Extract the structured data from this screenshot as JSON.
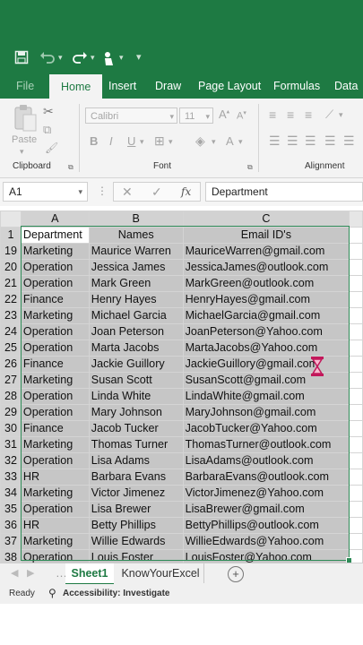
{
  "quick_access": {
    "save_icon": "save-icon",
    "undo_icon": "undo-icon",
    "redo_icon": "redo-icon",
    "touch_icon": "touch-mode-icon",
    "more_icon": "customize-icon"
  },
  "ribbon_tabs": [
    {
      "label": "File"
    },
    {
      "label": "Home"
    },
    {
      "label": "Insert"
    },
    {
      "label": "Draw"
    },
    {
      "label": "Page Layout"
    },
    {
      "label": "Formulas"
    },
    {
      "label": "Data"
    }
  ],
  "ribbon": {
    "clipboard_label": "Clipboard",
    "paste_label": "Paste",
    "font_label": "Font",
    "font_name": "Calibri",
    "font_size": "11",
    "alignment_label": "Alignment",
    "bold": "B",
    "italic": "I",
    "underline": "U",
    "increase_font": "A",
    "decrease_font": "A",
    "font_color": "A"
  },
  "formula_bar": {
    "name_box": "A1",
    "fx": "fx",
    "content": "Department"
  },
  "columns": [
    "A",
    "B",
    "C"
  ],
  "header_row": {
    "row": "1",
    "cells": [
      "Department",
      "Names",
      "Email ID's"
    ]
  },
  "rows": [
    {
      "n": "19",
      "dept": "Marketing",
      "name": "Maurice Warren",
      "email": "MauriceWarren@gmail.com"
    },
    {
      "n": "20",
      "dept": "Operation",
      "name": "Jessica James",
      "email": "JessicaJames@outlook.com"
    },
    {
      "n": "21",
      "dept": "Operation",
      "name": "Mark Green",
      "email": "MarkGreen@outlook.com"
    },
    {
      "n": "22",
      "dept": "Finance",
      "name": "Henry Hayes",
      "email": "HenryHayes@gmail.com"
    },
    {
      "n": "23",
      "dept": "Marketing",
      "name": "Michael Garcia",
      "email": "MichaelGarcia@gmail.com"
    },
    {
      "n": "24",
      "dept": "Operation",
      "name": "Joan Peterson",
      "email": "JoanPeterson@Yahoo.com"
    },
    {
      "n": "25",
      "dept": "Operation",
      "name": "Marta Jacobs",
      "email": "MartaJacobs@Yahoo.com"
    },
    {
      "n": "26",
      "dept": "Finance",
      "name": "Jackie Guillory",
      "email": "JackieGuillory@gmail.com"
    },
    {
      "n": "27",
      "dept": "Marketing",
      "name": "Susan Scott",
      "email": "SusanScott@gmail.com"
    },
    {
      "n": "28",
      "dept": "Operation",
      "name": "Linda White",
      "email": "LindaWhite@gmail.com"
    },
    {
      "n": "29",
      "dept": "Operation",
      "name": "Mary Johnson",
      "email": "MaryJohnson@gmail.com"
    },
    {
      "n": "30",
      "dept": "Finance",
      "name": "Jacob Tucker",
      "email": "JacobTucker@Yahoo.com"
    },
    {
      "n": "31",
      "dept": "Marketing",
      "name": "Thomas Turner",
      "email": "ThomasTurner@outlook.com"
    },
    {
      "n": "32",
      "dept": "Operation",
      "name": "Lisa Adams",
      "email": "LisaAdams@outlook.com"
    },
    {
      "n": "33",
      "dept": "HR",
      "name": "Barbara Evans",
      "email": "BarbaraEvans@outlook.com"
    },
    {
      "n": "34",
      "dept": "Marketing",
      "name": "Victor Jimenez",
      "email": "VictorJimenez@Yahoo.com"
    },
    {
      "n": "35",
      "dept": "Operation",
      "name": "Lisa Brewer",
      "email": "LisaBrewer@gmail.com"
    },
    {
      "n": "36",
      "dept": "HR",
      "name": "Betty Phillips",
      "email": "BettyPhillips@outlook.com"
    },
    {
      "n": "37",
      "dept": "Marketing",
      "name": "Willie Edwards",
      "email": "WillieEdwards@Yahoo.com"
    },
    {
      "n": "38",
      "dept": "Operation",
      "name": "Louis Foster",
      "email": "LouisFoster@Yahoo.com"
    }
  ],
  "sheet_tabs": [
    "Sheet1",
    "KnowYourExcel"
  ],
  "add_sheet": "+",
  "status": {
    "ready": "Ready",
    "accessibility": "Accessibility: Investigate"
  },
  "colors": {
    "excel_green": "#1e7a43",
    "selection": "#c6c6c6",
    "busy_cursor": "#c2185b"
  }
}
